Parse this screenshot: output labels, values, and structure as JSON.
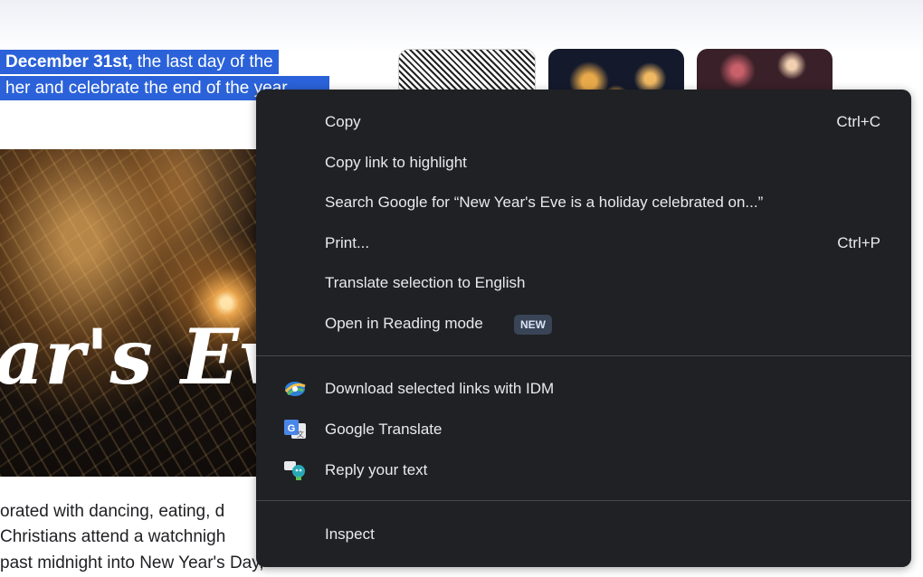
{
  "page": {
    "selection_line1_bold": "December 31st,",
    "selection_line1_rest": " the last day of the",
    "selection_line2": "her and celebrate the end of the year",
    "hero_text": "ar's Eve",
    "para_line1": "orated with dancing, eating, d",
    "para_line2": " Christians attend a watchnigh",
    "para_line3": " past midnight into New Year's Day,"
  },
  "context_menu": {
    "copy": {
      "label": "Copy",
      "shortcut": "Ctrl+C"
    },
    "copy_link": {
      "label": "Copy link to highlight"
    },
    "search": {
      "label": "Search Google for “New Year's Eve is a holiday celebrated on...”"
    },
    "print": {
      "label": "Print...",
      "shortcut": "Ctrl+P"
    },
    "translate_selection": {
      "label": "Translate selection to English"
    },
    "reading_mode": {
      "label": "Open in Reading mode",
      "badge": "NEW"
    },
    "idm": {
      "label": "Download selected links with IDM",
      "icon": "idm-icon"
    },
    "google_translate": {
      "label": "Google Translate",
      "icon": "google-translate-icon"
    },
    "reply_text": {
      "label": "Reply your text",
      "icon": "reply-bot-icon"
    },
    "inspect": {
      "label": "Inspect"
    }
  },
  "colors": {
    "menu_bg": "#202124",
    "menu_text": "#e8eaed",
    "selection": "#2b62d9",
    "badge_bg": "#394457"
  }
}
